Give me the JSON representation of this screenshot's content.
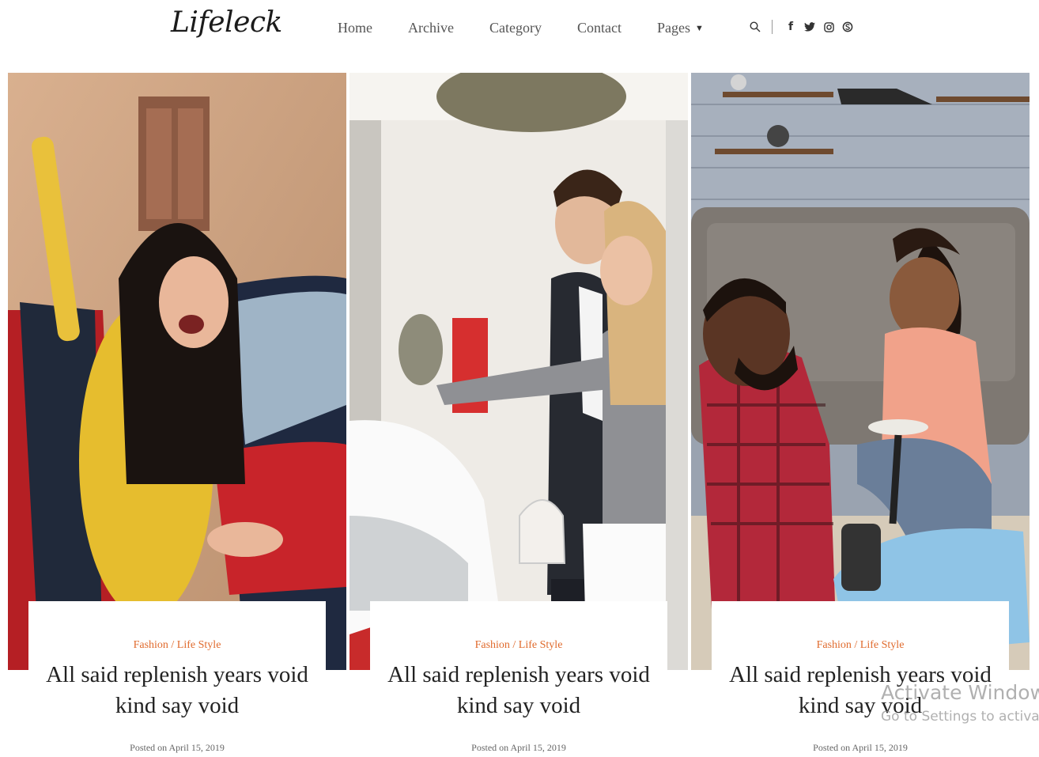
{
  "header": {
    "logo": "Lifeleck",
    "nav": [
      {
        "label": "Home"
      },
      {
        "label": "Archive"
      },
      {
        "label": "Category"
      },
      {
        "label": "Contact"
      },
      {
        "label": "Pages",
        "has_dropdown": true
      }
    ],
    "icons": [
      "search-icon",
      "facebook-icon",
      "twitter-icon",
      "instagram-icon",
      "skype-icon"
    ]
  },
  "posts": [
    {
      "category": "Fashion / Life Style",
      "title": "All said replenish years void kind say void",
      "meta": "Posted on April 15, 2019"
    },
    {
      "category": "Fashion / Life Style",
      "title": "All said replenish years void kind say void",
      "meta": "Posted on April 15, 2019"
    },
    {
      "category": "Fashion / Life Style",
      "title": "All said replenish years void kind say void",
      "meta": "Posted on April 15, 2019"
    }
  ],
  "watermark": {
    "line1": "Activate Windows",
    "line2": "Go to Settings to activate"
  },
  "colors": {
    "accent": "#e06a2c",
    "text": "#222222",
    "nav": "#555555"
  }
}
